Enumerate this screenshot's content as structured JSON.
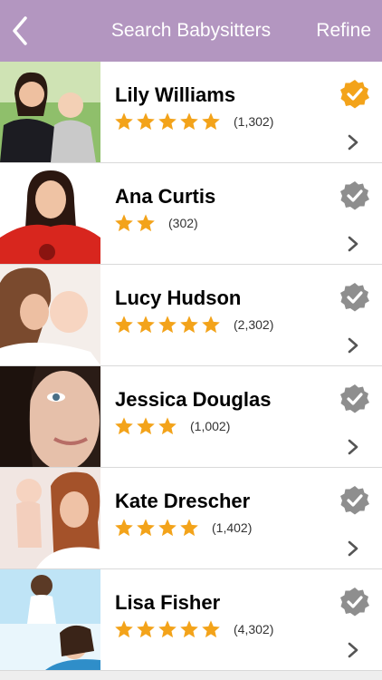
{
  "nav": {
    "title": "Search Babysitters",
    "refine_label": "Refine",
    "back_icon": "chevron-left-icon",
    "background": "#b396c0"
  },
  "colors": {
    "star": "#f3a31a",
    "badge_selected": "#f3a31a",
    "badge_unselected": "#8e8e8e"
  },
  "sitters": [
    {
      "name": "Lily Williams",
      "rating": 5,
      "reviews": "(1,302)",
      "selected": true
    },
    {
      "name": "Ana Curtis",
      "rating": 2,
      "reviews": "(302)",
      "selected": false
    },
    {
      "name": "Lucy Hudson",
      "rating": 5,
      "reviews": "(2,302)",
      "selected": false
    },
    {
      "name": "Jessica Douglas",
      "rating": 3,
      "reviews": "(1,002)",
      "selected": false
    },
    {
      "name": "Kate Drescher",
      "rating": 4,
      "reviews": "(1,402)",
      "selected": false
    },
    {
      "name": "Lisa Fisher",
      "rating": 5,
      "reviews": "(4,302)",
      "selected": false
    }
  ]
}
